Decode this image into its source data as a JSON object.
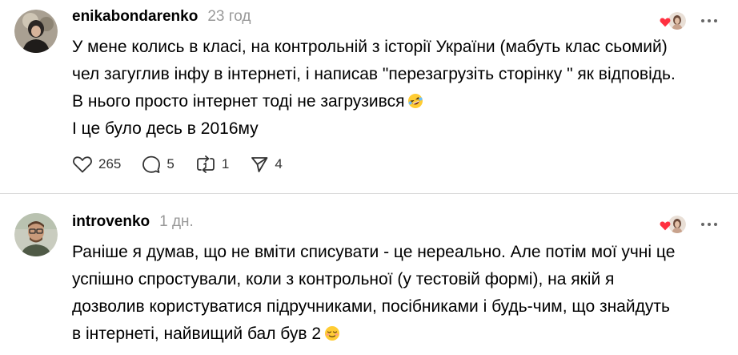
{
  "comments": [
    {
      "username": "enikabondarenko",
      "timestamp": "23 год",
      "lines": [
        "У мене колись в класі, на контрольній з історії України (мабуть клас сьомий)",
        "чел загуглив інфу в інтернеті, і написав \"перезагрузіть сторінку \" як відповідь.",
        "В нього просто інтернет тоді не загрузився",
        "І це було десь в 2016му"
      ],
      "emoji_after_line_3": "rofl-emoji",
      "stats": {
        "likes": "265",
        "replies": "5",
        "reposts": "1",
        "shares": "4"
      }
    },
    {
      "username": "introvenko",
      "timestamp": "1 дн.",
      "lines": [
        "Раніше я думав, що не вміти списувати - це нереально. Але потім мої учні це",
        "успішно спростували, коли з контрольної (у тестовій формі), на якій я",
        "дозволив користуватися підручниками, посібниками і будь-чим, що знайдуть",
        "в інтернеті, найвищий бал був 2"
      ],
      "emoji_after_line_4": "relieved-emoji"
    }
  ],
  "icons": {
    "like": "heart-outline-icon",
    "reply": "speech-bubble-icon",
    "repost": "repost-icon",
    "share": "paper-plane-icon",
    "more": "ellipsis-icon",
    "liked_by_author": "heart-with-avatar-icon"
  },
  "colors": {
    "text": "#000000",
    "muted": "#999999",
    "icon": "#333333",
    "heart": "#ff3040",
    "divider": "#dbdbdb"
  }
}
